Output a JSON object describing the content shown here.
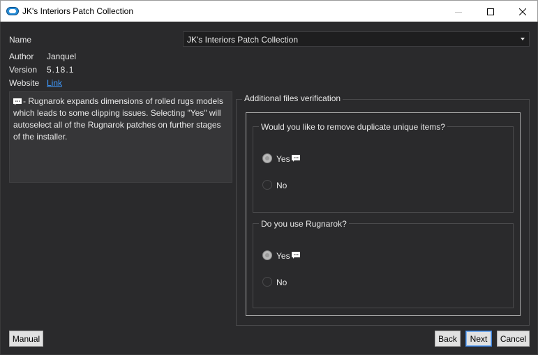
{
  "window": {
    "title": "JK's Interiors Patch Collection"
  },
  "info": {
    "name_label": "Name",
    "name_value": "JK's Interiors Patch Collection",
    "author_label": "Author",
    "author_value": "Janquel",
    "version_label": "Version",
    "version_value": "5.18.1",
    "website_label": "Website",
    "website_link": "Link"
  },
  "description": {
    "text": "- Rugnarok expands dimensions of rolled rugs models which leads to some clipping issues. Selecting \"Yes\" will autoselect all of the Rugnarok patches on further stages of the installer.",
    "icon": "speech-bubble-icon"
  },
  "step": {
    "title": "Additional files verification",
    "groups": [
      {
        "question": "Would you like to remove duplicate unique items?",
        "options": [
          {
            "label": "Yes",
            "selected": true,
            "has_info_icon": true
          },
          {
            "label": "No",
            "selected": false,
            "has_info_icon": false
          }
        ]
      },
      {
        "question": "Do you use Rugnarok?",
        "options": [
          {
            "label": "Yes",
            "selected": true,
            "has_info_icon": true
          },
          {
            "label": "No",
            "selected": false,
            "has_info_icon": false
          }
        ]
      }
    ]
  },
  "buttons": {
    "manual": "Manual",
    "back": "Back",
    "next": "Next",
    "cancel": "Cancel"
  },
  "colors": {
    "background": "#2a2a2c",
    "link": "#3f9bff",
    "accent_button_border": "#3c7fd6"
  }
}
